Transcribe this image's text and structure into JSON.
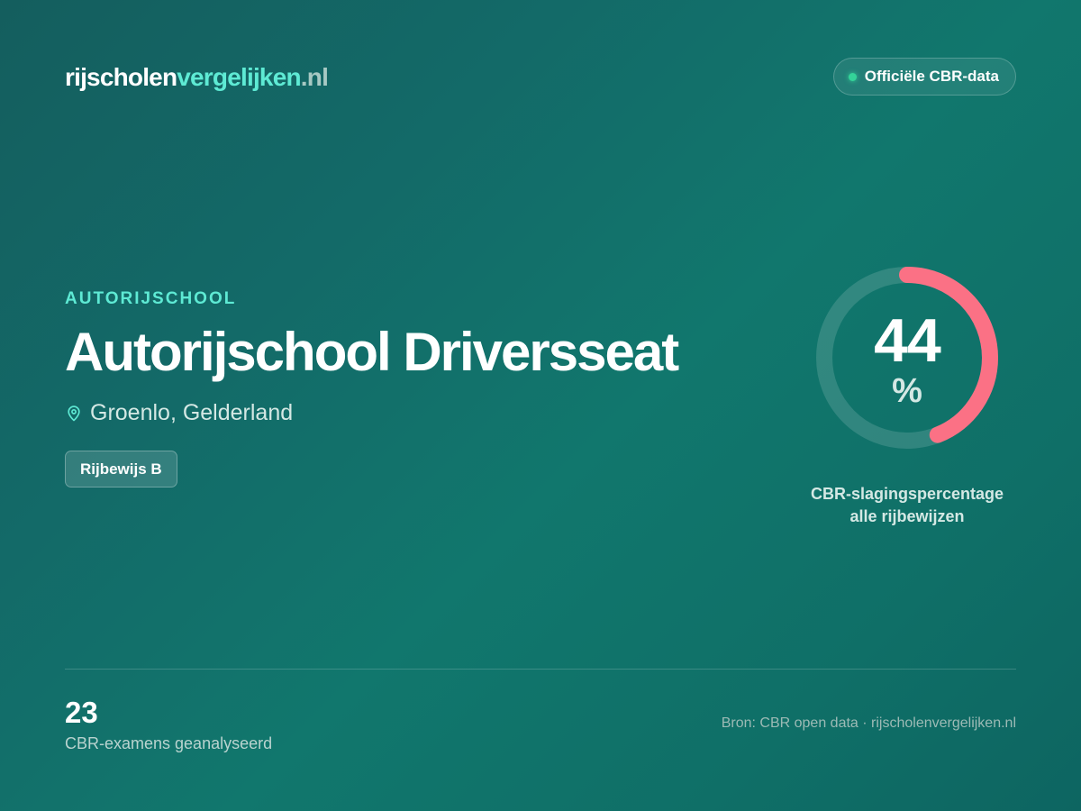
{
  "header": {
    "logo_part1": "rijscholen",
    "logo_part2": "vergelijken",
    "logo_part3": ".nl",
    "badge_label": "Officiële CBR-data"
  },
  "school": {
    "category": "AUTORIJSCHOOL",
    "name": "Autorijschool Driversseat",
    "location": "Groenlo, Gelderland",
    "license_tag": "Rijbewijs B",
    "location_icon": "map-pin-icon"
  },
  "pass_rate": {
    "value": "44",
    "percent": 44,
    "unit": "%",
    "caption_line1": "CBR-slagingspercentage",
    "caption_line2": "alle rijbewijzen"
  },
  "footer": {
    "exam_count": "23",
    "exam_label": "CBR-examens geanalyseerd",
    "source": "Bron: CBR open data · rijscholenvergelijken.nl"
  },
  "colors": {
    "accent": "#5eead4",
    "gauge_fill": "#fb7185",
    "status_dot": "#34d399"
  }
}
